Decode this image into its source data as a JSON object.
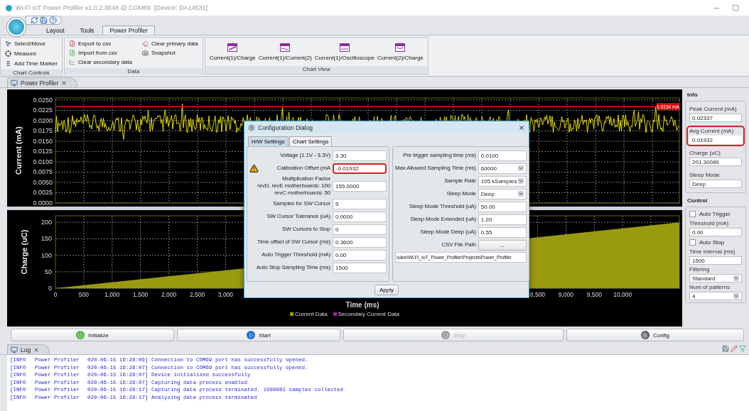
{
  "window": {
    "title": "Wi-Fi IoT Power Profiler v1.0.2.3048 @ COM69  [Device: DA14531]"
  },
  "ribbon": {
    "tabs": [
      {
        "label": "Layout",
        "selected": false
      },
      {
        "label": "Tools",
        "selected": false
      },
      {
        "label": "Power Profiler",
        "selected": true
      }
    ],
    "groups": [
      {
        "title": "Chart Controls",
        "kind": "list",
        "items": [
          "Select/Move",
          "Measure",
          "Add Time Marker"
        ]
      },
      {
        "title": "Data",
        "kind": "grid",
        "items": [
          "Export to csv",
          "Import from csv",
          "Clear secondary data",
          "Clear primary data",
          "Snapshot"
        ]
      },
      {
        "title": "Chart View",
        "kind": "large",
        "items": [
          "Current(1)/Charge",
          "Current(1)/Current(2)",
          "Current(1)/Oscilloscope",
          "Current(2)/Charge"
        ]
      }
    ]
  },
  "document_tab": {
    "label": "Power Profiler"
  },
  "current_chart": {
    "ylabel": "Current (mA)",
    "yticks": [
      "0.0250",
      "0.0225",
      "0.0200",
      "0.0175",
      "0.0150",
      "0.0125",
      "0.0100",
      "0.0075",
      "0.0050",
      "0.0025",
      "0.0000"
    ],
    "marker_label": "0.0234 mA"
  },
  "charge_chart": {
    "chart_data": {
      "type": "area",
      "xlabel": "Time (ms)",
      "ylabel": "Charge (uC)",
      "x": [
        0,
        11000
      ],
      "series": [
        {
          "name": "Current Data",
          "color": "#9a9a10",
          "values": [
            0,
            200
          ]
        },
        {
          "name": "Secondary Current Data",
          "color": "#a020a0",
          "values": [
            null,
            null
          ]
        }
      ],
      "grid": true,
      "xlim": [
        0,
        11000
      ],
      "ylim": [
        0,
        220
      ],
      "xticks": [
        {
          "value": 0,
          "label": "0"
        },
        {
          "value": 500,
          "label": "500"
        },
        {
          "value": 1000,
          "label": "1,000"
        },
        {
          "value": 1500,
          "label": "1,500"
        },
        {
          "value": 2000,
          "label": "2,000"
        },
        {
          "value": 2500,
          "label": "2,500"
        },
        {
          "value": 3000,
          "label": "3,000"
        },
        {
          "value": 8500,
          "label": "8,500"
        },
        {
          "value": 9000,
          "label": "9,000"
        },
        {
          "value": 9500,
          "label": "9,500"
        },
        {
          "value": 10000,
          "label": "10,000"
        }
      ],
      "yticks": [
        0,
        50,
        100,
        150,
        200
      ]
    }
  },
  "info": {
    "title": "Info",
    "fields": [
      {
        "label": "Peak Current (mA)",
        "value": "0.02337",
        "highlighted": false
      },
      {
        "label": "Avg Current (mA)",
        "value": "0.01932",
        "highlighted": true
      },
      {
        "label": "Charge (uC)",
        "value": "201.30089",
        "highlighted": false
      },
      {
        "label": "Sleep Mode",
        "value": "Deep",
        "highlighted": false
      }
    ]
  },
  "control": {
    "title": "Control",
    "items": [
      {
        "kind": "checkbox",
        "label": "Auto Trigger",
        "checked": false
      },
      {
        "kind": "field",
        "label": "Threshold (mA)",
        "value": "0.00"
      },
      {
        "kind": "checkbox",
        "label": "Auto Stop",
        "checked": false
      },
      {
        "kind": "field",
        "label": "Time Interval (ms)",
        "value": "1500"
      },
      {
        "kind": "select",
        "label": "Filtering",
        "value": "Standard"
      },
      {
        "kind": "select",
        "label": "Num of patterns",
        "value": "4"
      }
    ]
  },
  "actions": [
    {
      "label": "Initialize",
      "disabled": false
    },
    {
      "label": "Start",
      "disabled": false
    },
    {
      "label": "Stop",
      "disabled": true
    },
    {
      "label": "Config",
      "disabled": false
    }
  ],
  "dialog": {
    "title": "Configuration Dialog",
    "tabs": [
      {
        "label": "H/W Settings",
        "selected": true
      },
      {
        "label": "Chart Settings",
        "selected": false
      }
    ],
    "left": [
      {
        "kind": "text",
        "label": "Voltage (1.1V - 3.3V)",
        "value": "3.30",
        "warning": false,
        "highlighted": false
      },
      {
        "kind": "text",
        "label": "Calibration Offset (mA",
        "value": "-0.01932",
        "warning": true,
        "highlighted": true
      },
      {
        "kind": "text",
        "label": "Multiplication Factor\nrevD, revE motherboards: 100\nrevC motherboards: 50",
        "value": "155.0000",
        "warning": false,
        "highlighted": false
      },
      {
        "kind": "text",
        "label": "Samples for SW Cursor",
        "value": "5",
        "warning": false,
        "highlighted": false
      },
      {
        "kind": "text",
        "label": "SW Cursor Tolerance (uA)",
        "value": "0.0000",
        "warning": false,
        "highlighted": false
      },
      {
        "kind": "text",
        "label": "SW Cursors to Stop",
        "value": "0",
        "warning": false,
        "highlighted": false
      },
      {
        "kind": "text",
        "label": "Time offset of SW Cursor (ms)",
        "value": "0.3600",
        "warning": false,
        "highlighted": false
      },
      {
        "kind": "text",
        "label": "Auto Trigger Threshold (mA)",
        "value": "0.00",
        "warning": false,
        "highlighted": false
      },
      {
        "kind": "text",
        "label": "Auto Stop Sampling Time (ms)",
        "value": "1500",
        "warning": false,
        "highlighted": false
      }
    ],
    "right": [
      {
        "kind": "text",
        "label": "Pre trigger sampling time (ms)",
        "value": "0.0100"
      },
      {
        "kind": "select",
        "label": "Max Allowed Sampling Time (ms)",
        "value": "60000"
      },
      {
        "kind": "select",
        "label": "Sample Rate",
        "value": "105 kSamples"
      },
      {
        "kind": "select",
        "label": "Sleep Mode",
        "value": "Deep"
      },
      {
        "kind": "text",
        "label": "Sleep Mode Threshold (uA)",
        "value": "50.00"
      },
      {
        "kind": "text",
        "label": "Sleep Mode Extended (uA)",
        "value": "1.20"
      },
      {
        "kind": "text",
        "label": "Sleep Mode Deep (uA)",
        "value": "0.55"
      },
      {
        "kind": "button",
        "label": "CSV File Path",
        "value": "..."
      }
    ],
    "path": "\\ulee\\Wi-Fi_IoT_Power_Profiler\\Projects\\Power_Profiler",
    "apply": "Apply"
  },
  "log": {
    "tab": "Log",
    "rows": [
      {
        "level": "[INFO",
        "source": "Power Profiler",
        "message": "020-06-15 16:28:06] Connection to COM69 port has successfully opened."
      },
      {
        "level": "[INFO",
        "source": "Power Profiler",
        "message": "020-06-15 16:28:07] Connection to COM69 port has successfully opened."
      },
      {
        "level": "[INFO",
        "source": "Power Profiler",
        "message": "020-06-15 16:28:07] Device initialized successfully"
      },
      {
        "level": "[INFO",
        "source": "Power Profiler",
        "message": "020-06-15 16:28:07] Capturing data process enabled"
      },
      {
        "level": "[INFO",
        "source": "Power Profiler",
        "message": "020-06-15 16:28:17] Capturing data process terminated. 1099081 samples collected"
      },
      {
        "level": "[INFO",
        "source": "Power Profiler",
        "message": "020-06-15 16:28:17] Analyzing data process terminated"
      }
    ]
  }
}
